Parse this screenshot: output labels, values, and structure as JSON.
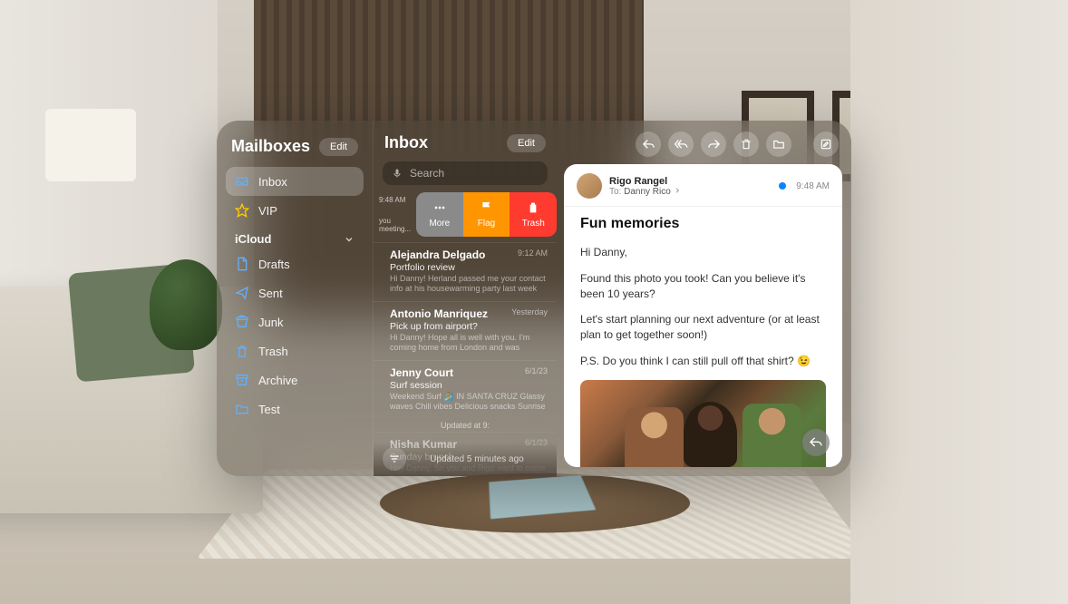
{
  "sidebar": {
    "title": "Mailboxes",
    "edit": "Edit",
    "top": [
      {
        "icon": "inbox",
        "label": "Inbox"
      },
      {
        "icon": "star",
        "label": "VIP"
      }
    ],
    "section": "iCloud",
    "icloud": [
      {
        "icon": "doc",
        "label": "Drafts"
      },
      {
        "icon": "sent",
        "label": "Sent"
      },
      {
        "icon": "junk",
        "label": "Junk"
      },
      {
        "icon": "trash",
        "label": "Trash"
      },
      {
        "icon": "archive",
        "label": "Archive"
      },
      {
        "icon": "folder",
        "label": "Test"
      }
    ]
  },
  "list": {
    "title": "Inbox",
    "edit": "Edit",
    "searchPlaceholder": "Search",
    "swipe": {
      "time": "9:48 AM",
      "preview": "you meeting...",
      "more": "More",
      "flag": "Flag",
      "trash": "Trash"
    },
    "messages": [
      {
        "from": "Alejandra Delgado",
        "time": "9:12 AM",
        "subject": "Portfolio review",
        "preview": "Hi Danny! Herland passed me your contact info at his housewarming party last week and said..."
      },
      {
        "from": "Antonio Manriquez",
        "time": "Yesterday",
        "subject": "Pick up from airport?",
        "preview": "Hi Danny! Hope all is well with you. I'm coming home from London and was wondering if you..."
      },
      {
        "from": "Jenny Court",
        "time": "6/1/23",
        "subject": "Surf session",
        "preview": "Weekend Surf 🏄 IN SANTA CRUZ Glassy waves Chill vibes Delicious snacks Sunrise to..."
      }
    ],
    "updatedSection": "Updated at 9:",
    "older": {
      "from": "Nisha Kumar",
      "time": "6/1/23",
      "subject": "Sunday brunch",
      "preview": "Hey Danny, So you and Rigo want to come to"
    },
    "status": "Updated 5 minutes ago"
  },
  "toolbar": {
    "reply": "reply",
    "replyAll": "reply-all",
    "forward": "forward",
    "delete": "delete",
    "move": "move",
    "compose": "compose"
  },
  "message": {
    "sender": "Rigo Rangel",
    "toLabel": "To:",
    "toName": "Danny Rico",
    "time": "9:48 AM",
    "subject": "Fun memories",
    "body": [
      "Hi Danny,",
      "Found this photo you took! Can you believe it's been 10 years?",
      "Let's start planning our next adventure (or at least plan to get together soon!)",
      "P.S. Do you think I can still pull off that shirt? 😉"
    ]
  }
}
